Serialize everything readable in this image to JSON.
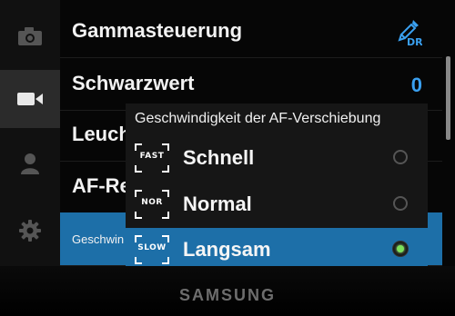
{
  "menu": {
    "rows": [
      {
        "label": "Gammasteuerung",
        "value": ""
      },
      {
        "label": "Schwarzwert",
        "value": "0"
      },
      {
        "label": "Leuch",
        "value": ""
      },
      {
        "label": "AF-Re",
        "value": ""
      },
      {
        "label": "Geschwin",
        "value": ""
      }
    ],
    "gamma_icon_text": "DR"
  },
  "sidebar": {
    "items": [
      {
        "icon": "camera-icon"
      },
      {
        "icon": "video-camera-icon"
      },
      {
        "icon": "person-icon"
      },
      {
        "icon": "gear-icon"
      }
    ],
    "active_index": 1
  },
  "popup": {
    "title": "Geschwindigkeit der AF-Verschiebung",
    "options": [
      {
        "tag": "FAST",
        "label": "Schnell",
        "selected": false
      },
      {
        "tag": "NOR",
        "label": "Normal",
        "selected": false
      },
      {
        "tag": "SLOW",
        "label": "Langsam",
        "selected": true
      }
    ]
  },
  "brand": "SAMSUNG",
  "colors": {
    "accent": "#1d6fa8",
    "value": "#3aa0f0",
    "radio_on": "#7be05a"
  }
}
